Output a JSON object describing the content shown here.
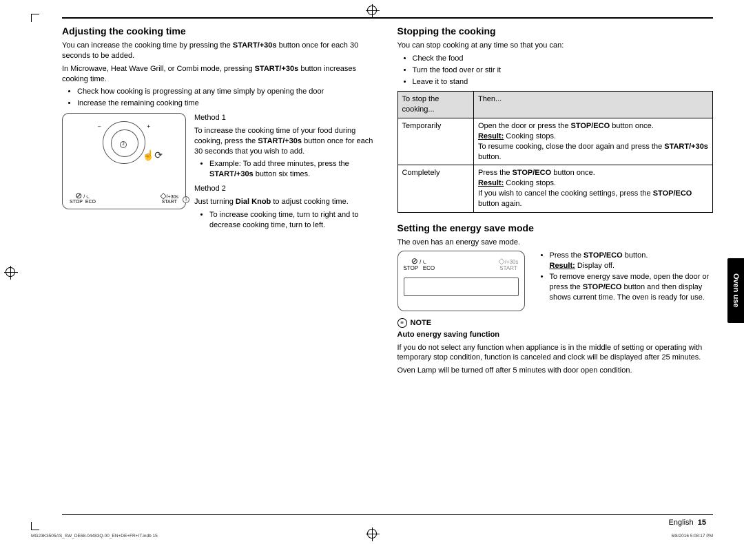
{
  "page": {
    "language": "English",
    "number": "15",
    "side_tab": "Oven use",
    "footer_file": "MG23K3505AS_SW_DE68-04483Q-00_EN+DE+FR+IT.indb   15",
    "footer_date": "6/8/2016   5:08:17 PM"
  },
  "left": {
    "heading": "Adjusting the cooking time",
    "p1_a": "You can increase the cooking time by pressing the ",
    "p1_b": "START/+30s",
    "p1_c": " button once for each 30 seconds to be added.",
    "p2_a": "In Microwave, Heat Wave Grill, or Combi mode, pressing ",
    "p2_b": "START/+30s",
    "p2_c": " button increases cooking time.",
    "bul1": "Check how cooking is progressing at any time simply by opening the door",
    "bul2": "Increase the remaining cooking time",
    "panel": {
      "minus": "–",
      "plus": "+",
      "callout1": "1",
      "callout2": "2",
      "stop": "STOP",
      "eco": "ECO",
      "start": "START",
      "plus30": "/+30s",
      "stop_sym": "⊘",
      "eco_sym": "⏾",
      "start_sym": "◇",
      "hand_sym": "☝⟳"
    },
    "m1_title": "Method 1",
    "m1_p_a": "To increase the cooking time of your food during cooking, press the ",
    "m1_p_b": "START/+30s",
    "m1_p_c": " button once for each 30 seconds that you wish to add.",
    "m1_ex_a": "Example: To add three minutes, press the ",
    "m1_ex_b": "START/+30s",
    "m1_ex_c": " button six times.",
    "m2_title": "Method 2",
    "m2_p_a": "Just turning ",
    "m2_p_b": "Dial Knob",
    "m2_p_c": " to adjust cooking time.",
    "m2_bul": "To increase cooking time, turn to right and to decrease cooking time, turn to left."
  },
  "right": {
    "h_stop": "Stopping the cooking",
    "stop_intro": "You can stop cooking at any time so that you can:",
    "stop_b1": "Check the food",
    "stop_b2": "Turn the food over or stir it",
    "stop_b3": "Leave it to stand",
    "table": {
      "th1": "To stop the cooking...",
      "th2": "Then...",
      "r1c1": "Temporarily",
      "r1_a": "Open the door or press the ",
      "r1_b": "STOP/ECO",
      "r1_c": " button once.",
      "r1_res_a": "Result:",
      "r1_res_b": "   Cooking stops.",
      "r1_resume_a": "To resume cooking, close the door again and press the ",
      "r1_resume_b": "START/+30s",
      "r1_resume_c": " button.",
      "r2c1": "Completely",
      "r2_a": "Press the ",
      "r2_b": "STOP/ECO",
      "r2_c": " button once.",
      "r2_res_a": "Result:",
      "r2_res_b": "   Cooking stops.",
      "r2_cancel_a": "If you wish to cancel the cooking settings, press the ",
      "r2_cancel_b": "STOP/ECO",
      "r2_cancel_c": " button again."
    },
    "h_energy": "Setting the energy save mode",
    "energy_intro": "The oven has an energy save mode.",
    "panel2": {
      "slash": " / ",
      "stop": "STOP",
      "eco": "ECO",
      "start": "START",
      "plus30": "/+30s",
      "stop_sym": "⊘",
      "eco_sym": "⏾",
      "start_sym": "◇"
    },
    "energy_b1_a": "Press the ",
    "energy_b1_b": "STOP/ECO",
    "energy_b1_c": " button.",
    "energy_b1_res_a": "Result:",
    "energy_b1_res_b": "      Display off.",
    "energy_b2_a": "To remove energy save mode, open the door or press the ",
    "energy_b2_b": "STOP/ECO",
    "energy_b2_c": " button and then display shows current time. The oven is ready for use.",
    "note_label": "NOTE",
    "note_sub": "Auto energy saving function",
    "note_p1": "If you do not select any function when appliance is in the middle of setting or operating with temporary stop condition, function is canceled and clock will be displayed after 25 minutes.",
    "note_p2": "Oven Lamp will be turned off after 5 minutes with door open condition."
  }
}
